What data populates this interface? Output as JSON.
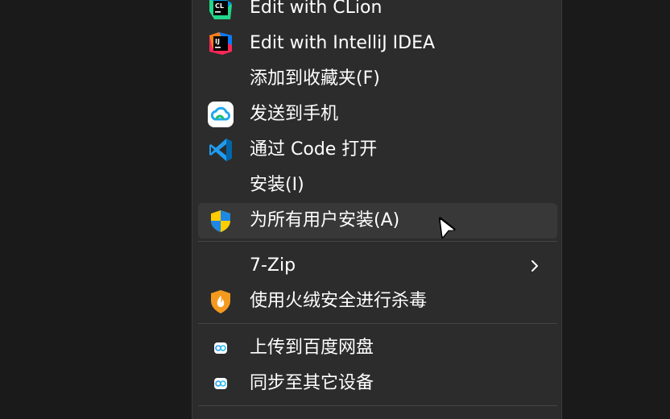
{
  "menu": {
    "items": [
      {
        "label": "Edit with CLion",
        "icon": "clion-icon"
      },
      {
        "label": "Edit with IntelliJ IDEA",
        "icon": "intellij-idea-icon"
      },
      {
        "label": "添加到收藏夹(F)",
        "icon": ""
      },
      {
        "label": "发送到手机",
        "icon": "cloud-phone-icon"
      },
      {
        "label": "通过 Code 打开",
        "icon": "vscode-icon"
      },
      {
        "label": "安装(I)",
        "icon": ""
      },
      {
        "label": "为所有用户安装(A)",
        "icon": "uac-shield-icon"
      },
      {
        "label": "7-Zip",
        "icon": "",
        "submenu": true
      },
      {
        "label": "使用火绒安全进行杀毒",
        "icon": "huorong-shield-icon"
      },
      {
        "label": "上传到百度网盘",
        "icon": "baidu-netdisk-icon"
      },
      {
        "label": "同步至其它设备",
        "icon": "baidu-netdisk-icon"
      }
    ],
    "hovered_index": 6,
    "colors": {
      "background": "#2c2c2c",
      "hover": "#383838",
      "text": "#ffffff",
      "separator": "#454545"
    }
  }
}
